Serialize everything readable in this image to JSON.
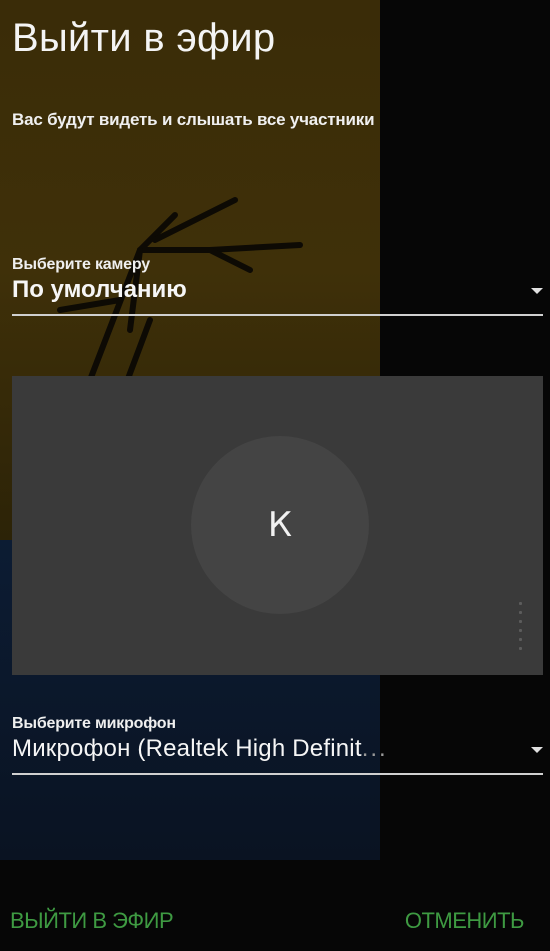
{
  "dialog": {
    "title": "Выйти в эфир",
    "subtitle": "Вас будут видеть и слышать все участники"
  },
  "camera": {
    "label": "Выберите камеру",
    "value": "По умолчанию"
  },
  "preview": {
    "avatar_letter": "К"
  },
  "microphone": {
    "label": "Выберите микрофон",
    "value": "Микрофон (Realtek High Definit",
    "overflow": "..."
  },
  "actions": {
    "go_live_label": "ВЫЙТИ В ЭФИР",
    "cancel_label": "ОТМЕНИТЬ"
  },
  "colors": {
    "accent": "#3e9a42",
    "preview_bg": "#3a3a3a",
    "avatar_bg": "#444444"
  },
  "icons": {
    "dropdown": "triangle-down-icon",
    "resize": "drag-handle-icon"
  }
}
